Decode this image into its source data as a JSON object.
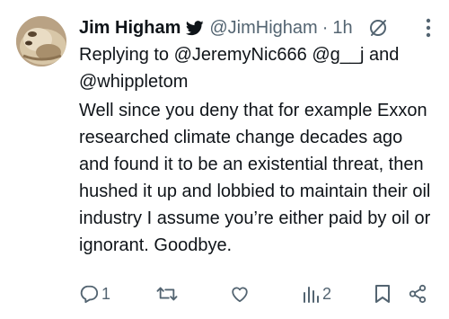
{
  "tweet": {
    "name": "Jim Higham",
    "handle": "@JimHigham",
    "separator": "·",
    "time": "1h",
    "replying_prefix": "Replying to ",
    "replying_to_1": "@JeremyNic666",
    "replying_to_2": "@g__j",
    "replying_and": " and ",
    "replying_to_3": "@whippletom",
    "body": "Well since you deny that for example Exxon researched climate change decades ago and found it to be an existential threat, then hushed it up and lobbied to maintain their oil industry I assume you’re either paid by oil or ignorant. Goodbye."
  },
  "actions": {
    "reply_count": "1",
    "retweet_count": "",
    "like_count": "",
    "views_count": "2"
  },
  "icons": {
    "verified_badge": "twitter-bird-icon",
    "edit": "edit-slashed-circle-icon",
    "more": "more-vertical-icon",
    "reply": "reply-icon",
    "retweet": "retweet-icon",
    "like": "heart-icon",
    "views": "views-chart-icon",
    "bookmark": "bookmark-icon",
    "share": "share-icon"
  },
  "colors": {
    "text": "#0f1419",
    "secondary": "#536471",
    "background": "#ffffff"
  }
}
